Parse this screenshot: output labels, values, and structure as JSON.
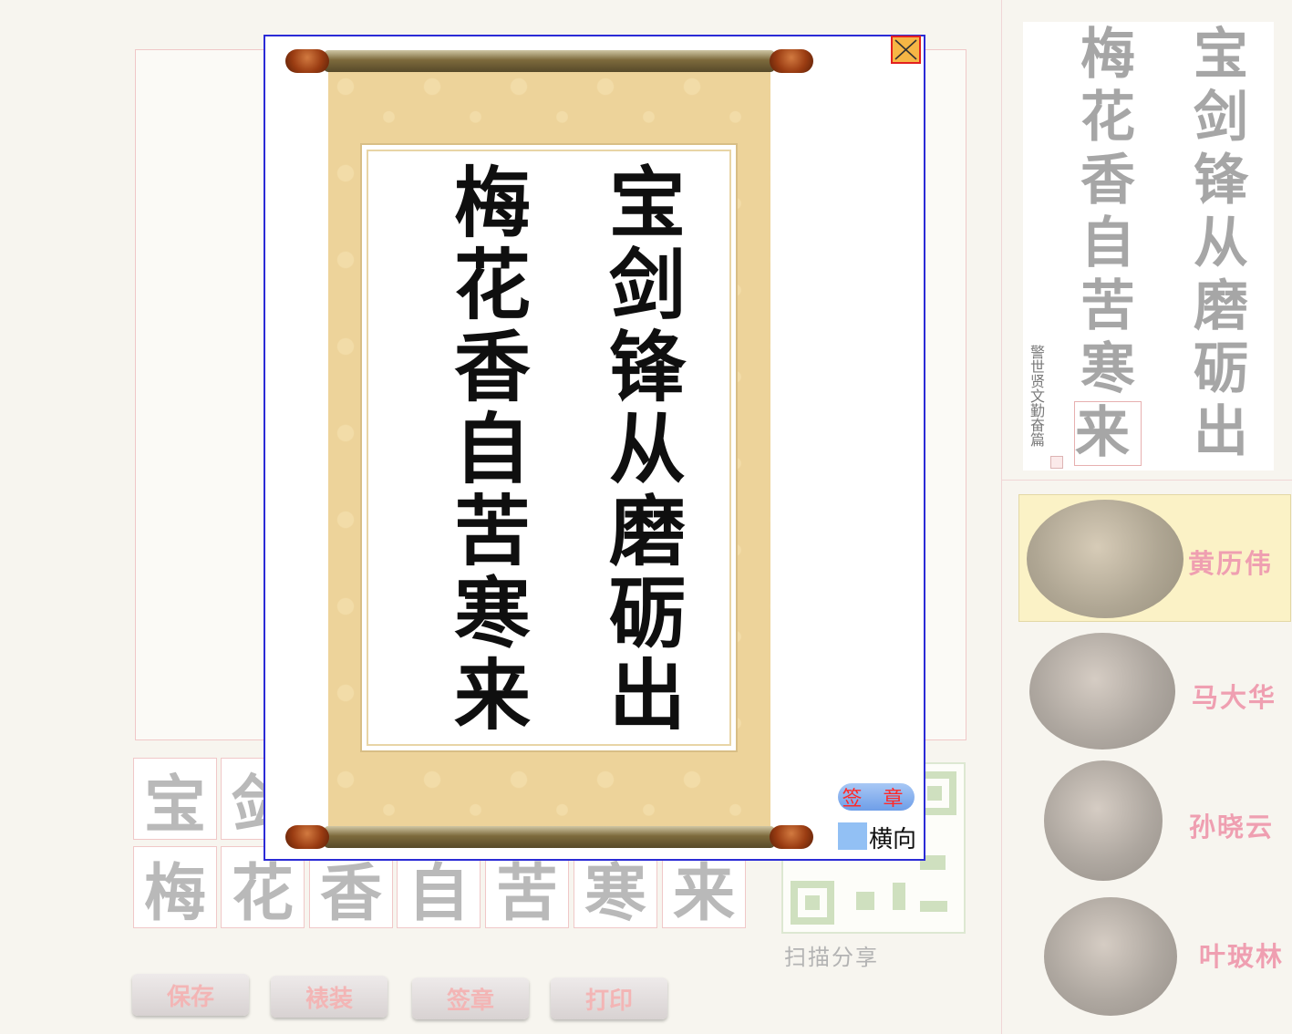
{
  "poem": {
    "right_column": [
      "宝",
      "剑",
      "锋",
      "从",
      "磨",
      "砺",
      "出"
    ],
    "left_column": [
      "梅",
      "花",
      "香",
      "自",
      "苦",
      "寒",
      "来"
    ]
  },
  "grid": {
    "row1": [
      "宝",
      "剑"
    ],
    "row2": [
      "梅",
      "花",
      "香",
      "自",
      "苦",
      "寒",
      "来"
    ]
  },
  "toolbar": {
    "save_label": "保存",
    "mount_label": "裱装",
    "seal_label": "签章",
    "print_label": "打印"
  },
  "share": {
    "qr_label": "扫描分享"
  },
  "preview": {
    "signature": "警世贤文勤奋篇"
  },
  "artists": [
    "黄历伟",
    "马大华",
    "孙晓云",
    "叶玻林"
  ],
  "modal": {
    "seal_button_label": "签 章",
    "orientation_label": "横向",
    "close_icon": "close-x-icon"
  },
  "colors": {
    "modal_border": "#2b2bd6",
    "close_border": "#e22020",
    "close_fill": "#f6b645",
    "mount_gold": "#edd39a",
    "artist_name": "#ef9fb1",
    "seal_text": "#ff2a2a"
  }
}
